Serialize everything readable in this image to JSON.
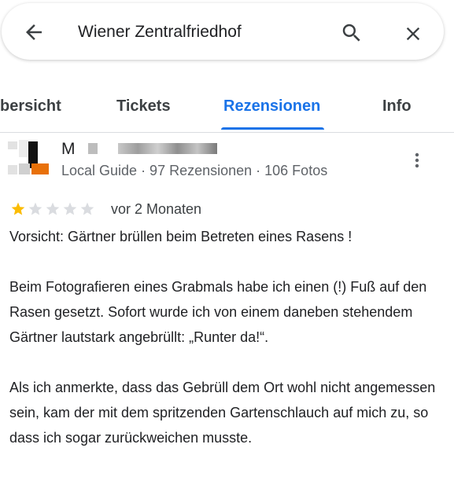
{
  "search": {
    "query": "Wiener Zentralfriedhof"
  },
  "tabs": [
    {
      "label": "bersicht"
    },
    {
      "label": "Tickets"
    },
    {
      "label": "Rezensionen"
    },
    {
      "label": "Info"
    }
  ],
  "active_tab": "Rezensionen",
  "review": {
    "reviewer_initial": "M",
    "meta": "Local Guide · 97 Rezensionen · 106 Fotos",
    "rating": 1,
    "rating_max": 5,
    "date": "vor 2 Monaten",
    "paragraphs": [
      "Vorsicht: Gärtner brüllen beim Betreten eines Rasens !",
      "Beim Fotografieren eines Grabmals habe ich einen (!) Fuß auf den Rasen gesetzt. Sofort wurde ich von einem daneben stehendem Gärtner lautstark angebrüllt: „Runter da!“.",
      "Als ich anmerkte, dass das Gebrüll dem Ort wohl nicht angemessen sein, kam der mit dem spritzenden Gartenschlauch auf mich zu, so dass ich sogar zurückweichen musste."
    ]
  },
  "colors": {
    "accent": "#1a73e8",
    "star_filled": "#fbbc04",
    "star_empty": "#dadce0",
    "avatar_accent": "#e8710a"
  },
  "icons": {
    "back": "arrow-back-icon",
    "search": "search-icon",
    "close": "close-icon",
    "more": "more-vert-icon"
  }
}
